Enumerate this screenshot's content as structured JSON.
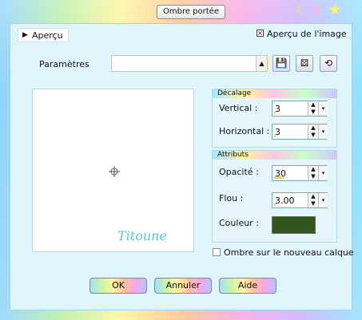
{
  "window": {
    "title": "Ombre portée"
  },
  "preview_toggle": {
    "label": "Aperçu",
    "icon": "triangle-right-icon"
  },
  "apercu_image": {
    "label": "Aperçu de l'image",
    "checked": true
  },
  "params": {
    "label": "Paramètres",
    "value": ""
  },
  "preview": {
    "signature": "Titoune"
  },
  "decalage": {
    "title": "Décalage",
    "vertical": {
      "label": "Vertical :",
      "value": "3",
      "fill": 0.04
    },
    "horizontal": {
      "label": "Horizontal :",
      "value": "3",
      "fill": 0.04
    }
  },
  "attributs": {
    "title": "Attributs",
    "opacite": {
      "label": "Opacité :",
      "value": "30",
      "fill": 0.3
    },
    "flou": {
      "label": "Flou :",
      "value": "3.00",
      "fill": 0.03
    },
    "couleur": {
      "label": "Couleur :",
      "value": "#33561f"
    }
  },
  "ombre_calque": {
    "label": "Ombre sur le nouveau calque",
    "checked": false
  },
  "buttons": {
    "ok": "OK",
    "annuler": "Annuler",
    "aide": "Aide"
  },
  "icons": {
    "save": "save-icon",
    "random": "dice-icon",
    "reset": "reset-icon"
  }
}
